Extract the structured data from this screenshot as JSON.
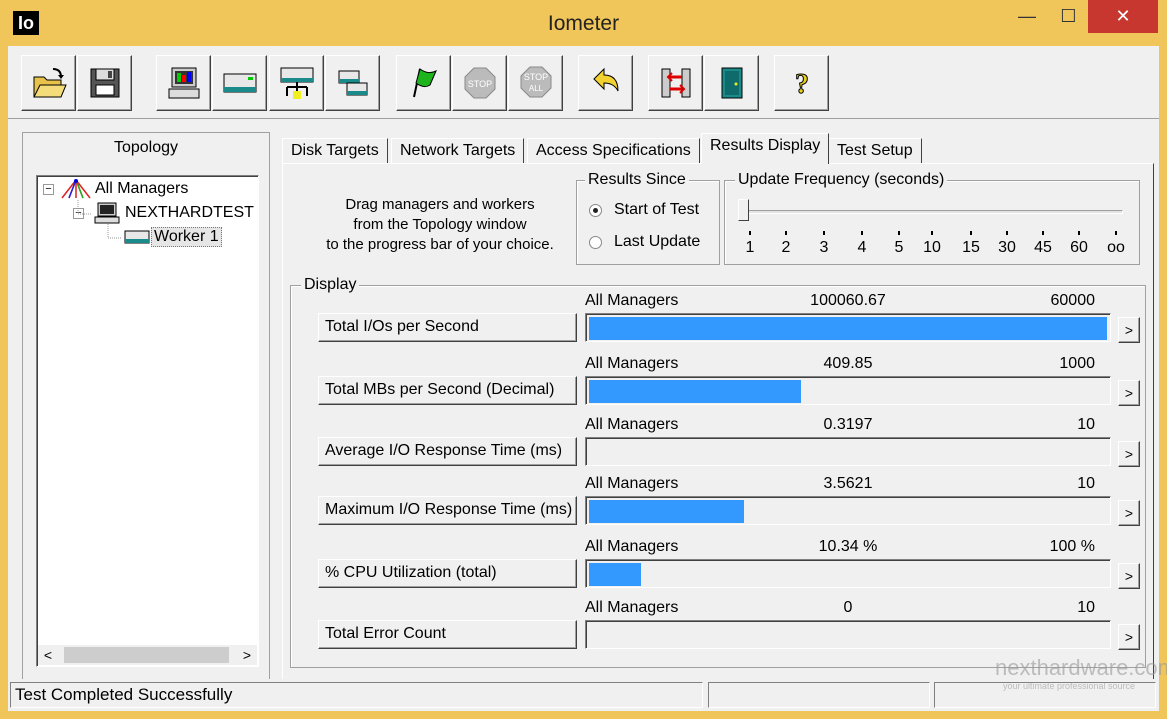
{
  "window": {
    "title": "Iometer",
    "app_icon_text": "Io",
    "controls": {
      "minimize": "—",
      "maximize": "☐",
      "close": "✕"
    }
  },
  "toolbar": {
    "buttons": [
      {
        "name": "open-button",
        "icon": "open-folder-icon"
      },
      {
        "name": "save-button",
        "icon": "floppy-disk-icon"
      },
      {
        "name": "start-display-button",
        "icon": "computer-icon"
      },
      {
        "name": "start-disk-worker-button",
        "icon": "disk-worker-icon"
      },
      {
        "name": "start-network-worker-button",
        "icon": "network-worker-icon"
      },
      {
        "name": "duplicate-worker-button",
        "icon": "duplicate-icon"
      },
      {
        "name": "start-tests-button",
        "icon": "green-flag-icon"
      },
      {
        "name": "stop-button",
        "icon": "stop-sign-icon",
        "label": "STOP"
      },
      {
        "name": "stop-all-button",
        "icon": "stop-all-icon",
        "label": "STOP",
        "sublabel": "ALL"
      },
      {
        "name": "reset-workers-button",
        "icon": "reset-arrow-icon"
      },
      {
        "name": "disconnect-button",
        "icon": "disconnect-icon"
      },
      {
        "name": "exit-button",
        "icon": "exit-door-icon"
      },
      {
        "name": "about-button",
        "icon": "help-question-icon",
        "label": "?"
      }
    ]
  },
  "topology": {
    "title": "Topology",
    "tree": [
      {
        "label": "All Managers",
        "icon": "managers-icon"
      },
      {
        "label": "NEXTHARDTEST",
        "icon": "computer-icon"
      },
      {
        "label": "Worker 1",
        "icon": "disk-worker-icon"
      }
    ],
    "scroll_left": "<",
    "scroll_right": ">"
  },
  "tabs": [
    {
      "label": "Disk Targets"
    },
    {
      "label": "Network Targets"
    },
    {
      "label": "Access Specifications"
    },
    {
      "label": "Results Display"
    },
    {
      "label": "Test Setup"
    }
  ],
  "results": {
    "drag_text": [
      "Drag managers and workers",
      "from the Topology window",
      "to the progress bar of your choice."
    ],
    "results_since": {
      "title": "Results Since",
      "options": [
        "Start of Test",
        "Last Update"
      ],
      "selected": 0
    },
    "update_frequency": {
      "title": "Update Frequency (seconds)",
      "ticks": [
        "1",
        "2",
        "3",
        "4",
        "5",
        "10",
        "15",
        "30",
        "45",
        "60",
        "oo"
      ],
      "selected_index": 0
    },
    "display": {
      "title": "Display",
      "metrics": [
        {
          "label": "Total I/Os per Second",
          "manager": "All Managers",
          "value": "100060.67",
          "max": "60000",
          "fill": 1.0
        },
        {
          "label": "Total MBs per Second (Decimal)",
          "manager": "All Managers",
          "value": "409.85",
          "max": "1000",
          "fill": 0.41
        },
        {
          "label": "Average I/O Response Time (ms)",
          "manager": "All Managers",
          "value": "0.3197",
          "max": "10",
          "fill": 0.0
        },
        {
          "label": "Maximum I/O Response Time (ms)",
          "manager": "All Managers",
          "value": "3.5621",
          "max": "10",
          "fill": 0.3
        },
        {
          "label": "% CPU Utilization (total)",
          "manager": "All Managers",
          "value": "10.34 %",
          "max": "100 %",
          "fill": 0.1
        },
        {
          "label": "Total Error Count",
          "manager": "All Managers",
          "value": "0",
          "max": "10",
          "fill": 0.0
        }
      ],
      "more_label": ">"
    }
  },
  "status": {
    "message": "Test Completed Successfully"
  },
  "watermark": {
    "brand": "nexthardware.com",
    "tagline": "your ultimate professional source"
  }
}
